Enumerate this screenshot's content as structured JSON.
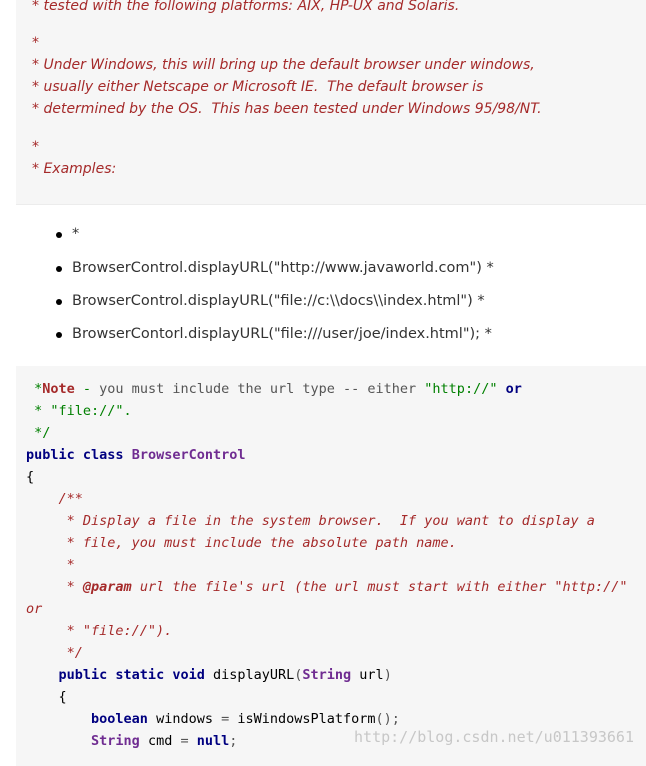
{
  "comment_block": {
    "lines": [
      "* tested with the following platforms: AIX, HP-UX and Solaris.",
      "*",
      "* Under Windows, this will bring up the default browser under windows,",
      "* usually either Netscape or Microsoft IE.  The default browser is",
      "* determined by the OS.  This has been tested under Windows 95/98/NT.",
      "*",
      "* Examples:"
    ]
  },
  "list_items": [
    "*",
    "BrowserControl.displayURL(\"http://www.javaworld.com\") *",
    "BrowserControl.displayURL(\"file://c:\\\\docs\\\\index.html\") *",
    "BrowserContorl.displayURL(\"file:///user/joe/index.html\"); *"
  ],
  "code": {
    "l1_star": " *",
    "l1_note": "Note",
    "l1_dash": " -",
    "l1_text": " you must include the url type --",
    "l1_either": " either",
    "l1_str": " \"http://\"",
    "l1_or": " or",
    "l2": " * \"file://\".",
    "l3": " */",
    "l4_public": "public",
    "l4_class": " class",
    "l4_name": " BrowserControl",
    "l5": "{",
    "l6": "    /**",
    "l7": "     * Display a file in the system browser.  If you want to display a",
    "l8": "     * file, you must include the absolute path name.",
    "l9": "     *",
    "l10_star": "     * ",
    "l10_tag": "@param",
    "l10_rest": " url the file's url (the url must start with either \"http://\"",
    "l11": "or",
    "l12": "     * \"file://\").",
    "l13": "     */",
    "l14_indent": "    ",
    "l14_public": "public",
    "l14_static": " static",
    "l14_void": " void",
    "l14_method": " displayURL",
    "l14_paren": "(",
    "l14_type": "String",
    "l14_arg": " url",
    "l14_close": ")",
    "l15": "    {",
    "l16_indent": "        ",
    "l16_type": "boolean",
    "l16_var": " windows",
    "l16_eq": " =",
    "l16_call": " isWindowsPlatform",
    "l16_end": "();",
    "l17_indent": "        ",
    "l17_type": "String",
    "l17_var": " cmd",
    "l17_eq": " =",
    "l17_null": " null",
    "l17_end": ";"
  },
  "watermark": "http://blog.csdn.net/u011393661"
}
